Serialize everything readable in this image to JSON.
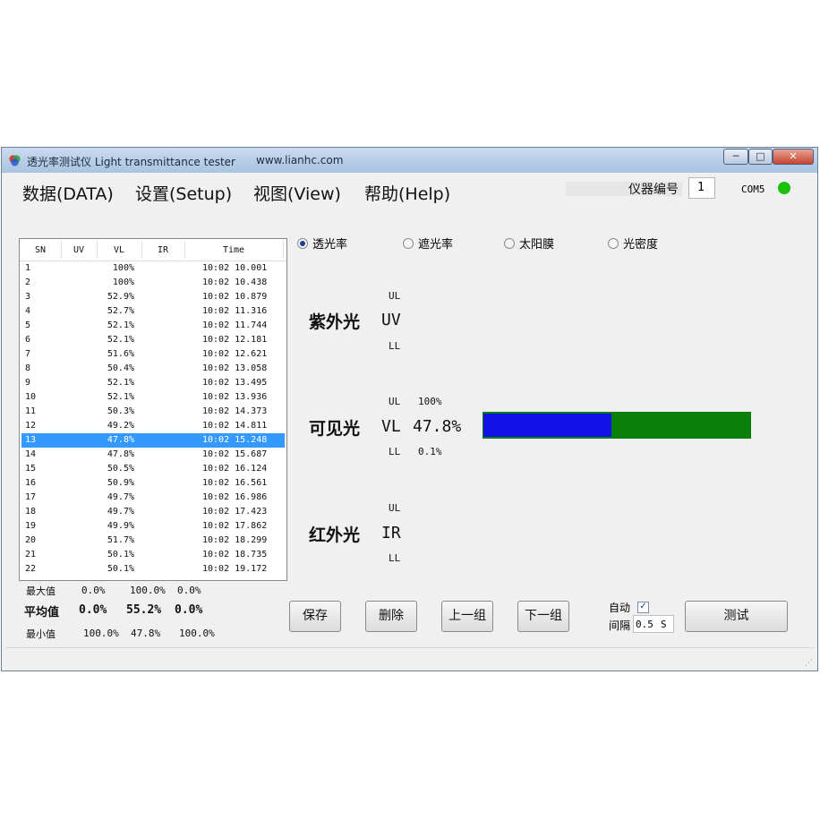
{
  "window": {
    "title": "透光率测试仪 Light transmittance tester",
    "url": "www.lianhc.com",
    "controls": {
      "minimize": "─",
      "maximize": "□",
      "close": "✕"
    }
  },
  "menu": [
    "数据(DATA)",
    "设置(Setup)",
    "视图(View)",
    "帮助(Help)"
  ],
  "device": {
    "label": "仪器编号",
    "number": "1",
    "port": "COM5",
    "led_color": "#19c20b"
  },
  "table": {
    "headers": [
      "SN",
      "UV",
      "VL",
      "IR",
      "Time"
    ],
    "selected_index": 12,
    "rows": [
      {
        "sn": "1",
        "vl": "100%",
        "time": "10:02 10.001"
      },
      {
        "sn": "2",
        "vl": "100%",
        "time": "10:02 10.438"
      },
      {
        "sn": "3",
        "vl": "52.9%",
        "time": "10:02 10.879"
      },
      {
        "sn": "4",
        "vl": "52.7%",
        "time": "10:02 11.316"
      },
      {
        "sn": "5",
        "vl": "52.1%",
        "time": "10:02 11.744"
      },
      {
        "sn": "6",
        "vl": "52.1%",
        "time": "10:02 12.181"
      },
      {
        "sn": "7",
        "vl": "51.6%",
        "time": "10:02 12.621"
      },
      {
        "sn": "8",
        "vl": "50.4%",
        "time": "10:02 13.058"
      },
      {
        "sn": "9",
        "vl": "52.1%",
        "time": "10:02 13.495"
      },
      {
        "sn": "10",
        "vl": "52.1%",
        "time": "10:02 13.936"
      },
      {
        "sn": "11",
        "vl": "50.3%",
        "time": "10:02 14.373"
      },
      {
        "sn": "12",
        "vl": "49.2%",
        "time": "10:02 14.811"
      },
      {
        "sn": "13",
        "vl": "47.8%",
        "time": "10:02 15.248"
      },
      {
        "sn": "14",
        "vl": "47.8%",
        "time": "10:02 15.687"
      },
      {
        "sn": "15",
        "vl": "50.5%",
        "time": "10:02 16.124"
      },
      {
        "sn": "16",
        "vl": "50.9%",
        "time": "10:02 16.561"
      },
      {
        "sn": "17",
        "vl": "49.7%",
        "time": "10:02 16.986"
      },
      {
        "sn": "18",
        "vl": "49.7%",
        "time": "10:02 17.423"
      },
      {
        "sn": "19",
        "vl": "49.9%",
        "time": "10:02 17.862"
      },
      {
        "sn": "20",
        "vl": "51.7%",
        "time": "10:02 18.299"
      },
      {
        "sn": "21",
        "vl": "50.1%",
        "time": "10:02 18.735"
      },
      {
        "sn": "22",
        "vl": "50.1%",
        "time": "10:02 19.172"
      }
    ]
  },
  "stats": {
    "max": {
      "label": "最大值",
      "uv": "0.0%",
      "vl": "100.0%",
      "ir": "0.0%"
    },
    "avg": {
      "label": "平均值",
      "uv": "0.0%",
      "vl": "55.2%",
      "ir": "0.0%"
    },
    "min": {
      "label": "最小值",
      "uv": "100.0%",
      "vl": "47.8%",
      "ir": "100.0%"
    }
  },
  "modes": [
    {
      "label": "透光率",
      "selected": true
    },
    {
      "label": "遮光率",
      "selected": false
    },
    {
      "label": "太阳膜",
      "selected": false
    },
    {
      "label": "光密度",
      "selected": false
    }
  ],
  "uv": {
    "name": "紫外光",
    "code": "UV",
    "ul": "UL",
    "ll": "LL"
  },
  "vl": {
    "name": "可见光",
    "code": "VL",
    "value": "47.8%",
    "ul": "UL",
    "ul_value": "100%",
    "ll": "LL",
    "ll_value": "0.1%",
    "bar_fraction": 0.478,
    "bar_color": "#1212e8",
    "bar_bg": "#0a7f0a"
  },
  "ir": {
    "name": "红外光",
    "code": "IR",
    "ul": "UL",
    "ll": "LL"
  },
  "buttons": {
    "save": "保存",
    "delete": "删除",
    "prev": "上一组",
    "next": "下一组",
    "test": "测试"
  },
  "auto": {
    "label": "自动",
    "checked": true,
    "check_mark": "✓",
    "interval_label": "间隔",
    "interval_value": "0.5",
    "interval_unit": "S"
  }
}
